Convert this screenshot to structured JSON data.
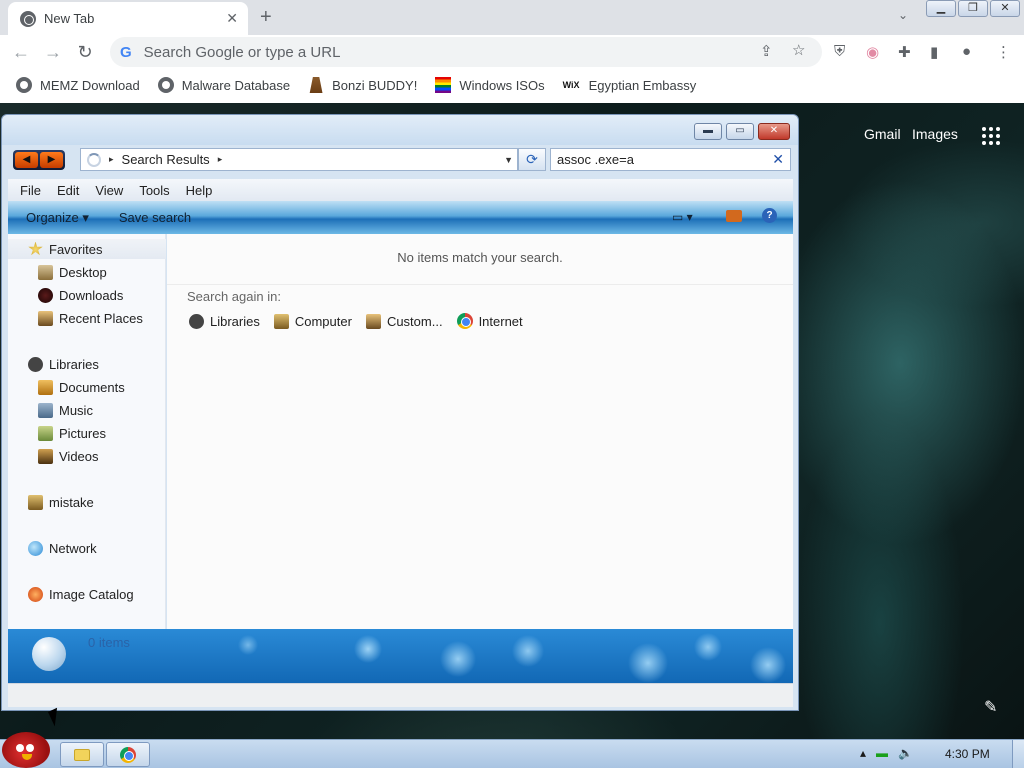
{
  "browser": {
    "tab": {
      "title": "New Tab",
      "close": "✕"
    },
    "new_tab_symbol": "+",
    "tabstrip_caret": "⌄",
    "window_controls": {
      "minimize": "▁",
      "restore": "❐",
      "close": "✕"
    },
    "nav": {
      "back": "←",
      "forward": "→",
      "reload": "↻"
    },
    "omnibox": {
      "placeholder": "Search Google or type a URL",
      "google_letter": "G"
    },
    "omnibox_icons": {
      "share": "⇪",
      "bookmark": "☆"
    },
    "extension_icons": {
      "ublock": "⛨",
      "profile_ext": "◉",
      "puzzle": "✚",
      "sidepanel": "▮",
      "account": "●",
      "menu": "⋮"
    },
    "bookmarks": [
      {
        "label": "MEMZ Download",
        "icon": "globe-icon"
      },
      {
        "label": "Malware Database",
        "icon": "globe-icon"
      },
      {
        "label": "Bonzi BUDDY!",
        "icon": "bonzi-icon"
      },
      {
        "label": "Windows ISOs",
        "icon": "rainbow-flag-icon"
      },
      {
        "label": "Egyptian Embassy",
        "icon": "wix-icon",
        "icon_text": "WiX"
      }
    ]
  },
  "newtab_page": {
    "gmail": "Gmail",
    "images": "Images",
    "customize_icon": "✎"
  },
  "explorer": {
    "caption": {
      "minimize": "▬",
      "maximize": "▭",
      "close": "✕"
    },
    "back_forward": {
      "back": "◀",
      "forward": "▶"
    },
    "address": {
      "crumb": "Search Results",
      "arrow": "▸",
      "dropdown": "▼"
    },
    "refresh_symbol": "⟳",
    "search": {
      "value": "assoc .exe=a",
      "clear": "✕"
    },
    "menu": [
      "File",
      "Edit",
      "View",
      "Tools",
      "Help"
    ],
    "commands": {
      "organize": "Organize ▾",
      "save_search": "Save search",
      "views": "▭ ▾",
      "help": "?"
    },
    "nav_pane": {
      "favorites": "Favorites",
      "desktop": "Desktop",
      "downloads": "Downloads",
      "recent_places": "Recent Places",
      "libraries": "Libraries",
      "documents": "Documents",
      "music": "Music",
      "pictures": "Pictures",
      "videos": "Videos",
      "mistake": "mistake",
      "network": "Network",
      "image_catalog": "Image Catalog"
    },
    "content": {
      "empty_message": "No items match your search.",
      "search_again_label": "Search again in:",
      "locations": [
        "Libraries",
        "Computer",
        "Custom...",
        "Internet"
      ]
    },
    "details": {
      "items_count": "0 items"
    }
  },
  "taskbar": {
    "clock": "4:30 PM",
    "tray": {
      "arrow": "▴",
      "battery": "▬",
      "volume": "🔈"
    }
  },
  "colors": {
    "explorer_accent": "#1d6fb8",
    "chrome_tabstrip": "#dee1e6",
    "taskbar": "#b8cfe8"
  }
}
